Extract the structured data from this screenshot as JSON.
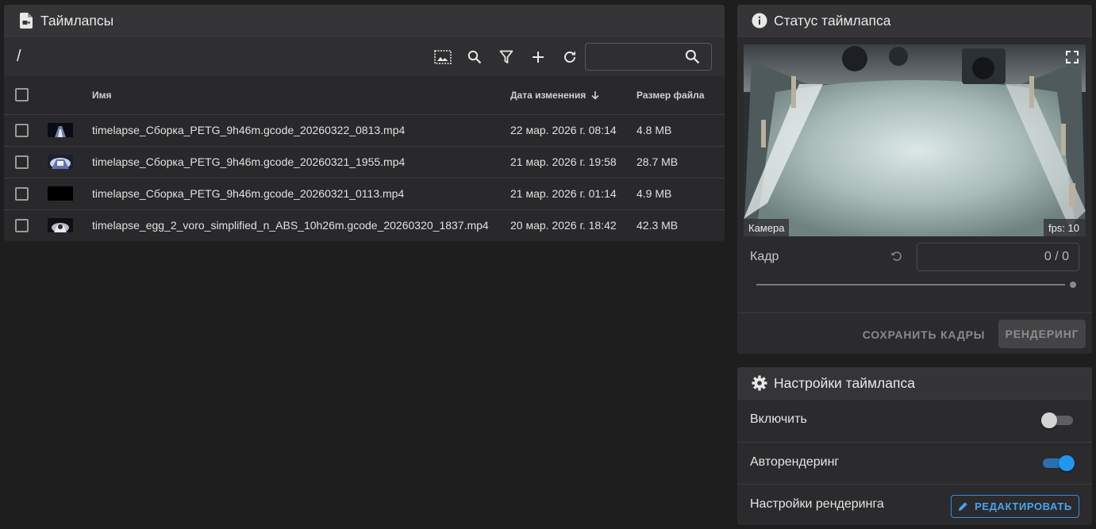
{
  "files_panel": {
    "title": "Таймлапсы",
    "path": "/",
    "search": {
      "value": "",
      "placeholder": ""
    },
    "toolbar_icons": [
      "thumbnail-toggle-icon",
      "search-icon",
      "filter-icon",
      "add-icon",
      "refresh-icon"
    ],
    "columns": {
      "name": "Имя",
      "date": "Дата изменения",
      "size": "Размер файла"
    },
    "sort": {
      "column": "date",
      "direction": "desc"
    },
    "rows": [
      {
        "name": "timelapse_Сборка_PETG_9h46m.gcode_20260322_0813.mp4",
        "date": "22 мар. 2026 г. 08:14",
        "size": "4.8 MB"
      },
      {
        "name": "timelapse_Сборка_PETG_9h46m.gcode_20260321_1955.mp4",
        "date": "21 мар. 2026 г. 19:58",
        "size": "28.7 MB"
      },
      {
        "name": "timelapse_Сборка_PETG_9h46m.gcode_20260321_0113.mp4",
        "date": "21 мар. 2026 г. 01:14",
        "size": "4.9 MB"
      },
      {
        "name": "timelapse_egg_2_voro_simplified_n_ABS_10h26m.gcode_20260320_1837.mp4",
        "date": "20 мар. 2026 г. 18:42",
        "size": "42.3 MB"
      }
    ]
  },
  "status_panel": {
    "title": "Статус таймлапса",
    "camera_label": "Камера",
    "fps_label": "fps: 10",
    "frame_label": "Кадр",
    "frame_value": "0 / 0",
    "save_frames_label": "СОХРАНИТЬ КАДРЫ",
    "render_label": "РЕНДЕРИНГ"
  },
  "settings_panel": {
    "title": "Настройки таймлапса",
    "enable_label": "Включить",
    "enable_on": false,
    "autorender_label": "Авторендеринг",
    "autorender_on": true,
    "render_settings_label": "Настройки рендеринга",
    "edit_label": "РЕДАКТИРОВАТЬ"
  },
  "colors": {
    "background": "#1e1e1e",
    "card": "#2b2b2d",
    "accent": "#2196f3",
    "toggle_off": "#cfcfcf"
  }
}
